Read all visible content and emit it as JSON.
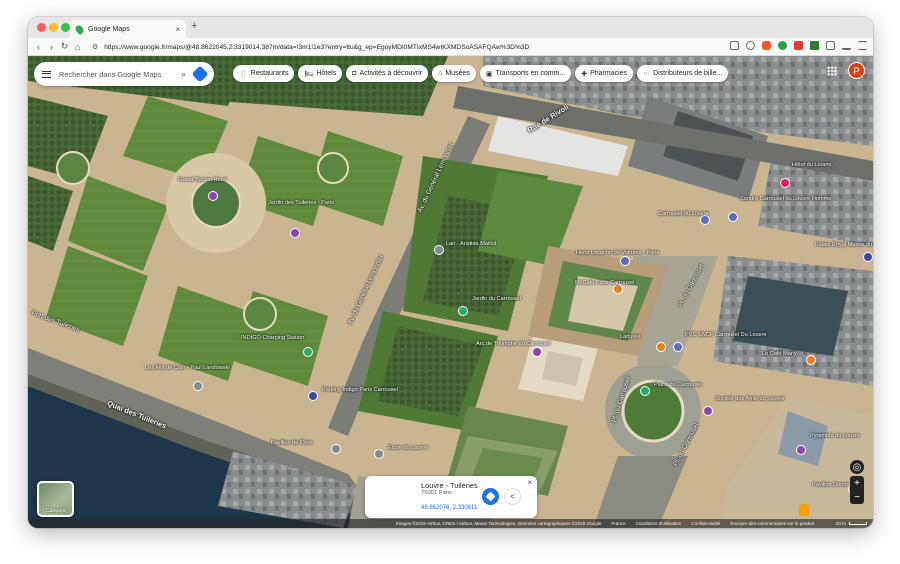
{
  "browser": {
    "tab_title": "Google Maps",
    "tab_close": "×",
    "new_tab": "+",
    "url": "https://www.google.fr/maps/@48.8622045,2.3319014,387m/data=!3m1!1e3?entry=ttu&g_ep=EgoyMDI0MTIxMS4wIKXMDSoASAFQAw%3D%3D",
    "nav": {
      "back": "‹",
      "forward": "›",
      "reload": "↻",
      "home": "⌂"
    },
    "traffic_colors": [
      "#ff5f57",
      "#febc2e",
      "#28c840"
    ]
  },
  "maps": {
    "search_placeholder": "Rechercher dans Google Maps",
    "chips": [
      {
        "icon": "restaurant-icon",
        "glyph": "🍴",
        "label": "Restaurants"
      },
      {
        "icon": "hotel-icon",
        "glyph": "🛏",
        "label": "Hôtels"
      },
      {
        "icon": "camera-icon",
        "glyph": "◘",
        "label": "Activités à découvrir"
      },
      {
        "icon": "museum-icon",
        "glyph": "⌂",
        "label": "Musées"
      },
      {
        "icon": "transit-icon",
        "glyph": "▣",
        "label": "Transports en comm..."
      },
      {
        "icon": "pharmacy-icon",
        "glyph": "✚",
        "label": "Pharmacies"
      },
      {
        "icon": "atm-icon",
        "glyph": "···",
        "label": "Distributeurs de bille..."
      }
    ],
    "avatar_initial": "P",
    "layers_label": "Calques",
    "zoom_in": "+",
    "zoom_out": "−",
    "places": [
      {
        "name": "Grand Bassin Rond",
        "pin_color": "#8e44ad"
      },
      {
        "name": "Jardin des Tuileries - Paris",
        "pin_color": "#8e44ad"
      },
      {
        "name": "Lair - Aristide Maillol",
        "pin_color": "#7f8c8d"
      },
      {
        "name": "Hertz Location de Voitures - Paris",
        "pin_color": "#5c6bc0"
      },
      {
        "name": "McCafé Paris Carrousel",
        "pin_color": "#e67e22"
      },
      {
        "name": "Jardin du Carrousel",
        "pin_color": "#27ae60"
      },
      {
        "name": "Arc de Triomphe du Carrousel",
        "pin_color": "#8e44ad"
      },
      {
        "name": "INDIGO Charging Station",
        "pin_color": "#27ae60"
      },
      {
        "name": "Les Fils de Caïn - Paul Landowski",
        "pin_color": "#7f8c8d"
      },
      {
        "name": "Parking Indigo Paris Carrousel",
        "pin_color": "#3949ab"
      },
      {
        "name": "Pavillon de Flore",
        "pin_color": "#7f8c8d"
      },
      {
        "name": "Ecole du Louvre",
        "pin_color": "#7f8c8d"
      },
      {
        "name": "Carrousel du Louvre",
        "pin_color": "#5c6bc0"
      },
      {
        "name": "Sandro Carrousel du Louvre Homme",
        "pin_color": "#5c6bc0"
      },
      {
        "name": "Hôtel du Louvre",
        "pin_color": "#e91e63"
      },
      {
        "name": "Palais Royal Musée du Louvre",
        "pin_color": "#3949ab"
      },
      {
        "name": "Ladurée",
        "pin_color": "#e67e22"
      },
      {
        "name": "PVC SNCF Carrousel Du Louvre",
        "pin_color": "#5c6bc0"
      },
      {
        "name": "Le Café Marly",
        "pin_color": "#e67e22"
      },
      {
        "name": "Place du Carrousel",
        "pin_color": "#27ae60"
      },
      {
        "name": "Société des Amis du Louvre",
        "pin_color": "#8e44ad"
      },
      {
        "name": "Pyramide du Louvre",
        "pin_color": "#8e44ad"
      },
      {
        "name": "Pavillon Denon",
        "pin_color": "#7f8c8d"
      }
    ],
    "streets": [
      "Rue de Rivoli",
      "Av. du Général Lemonnier",
      "Av. du Général Lemonnier",
      "Quai des Tuileries",
      "Pl. du Carrousel",
      "Pl. du Carrousel",
      "Pl. du Carrousel",
      "Port des Tuileries"
    ],
    "info": {
      "title": "Louvre - Tuileries",
      "subtitle": "75001 Paris",
      "coords": "48.862076, 2.330611",
      "close": "×",
      "share": "<"
    },
    "footer": {
      "attribution": "Images ©2025 Airbus, CNES / Airbus, Maxar Technologies, Données cartographiques ©2025 Google",
      "links": [
        "France",
        "Conditions d'utilisation",
        "Confidentialité",
        "Envoyer des commentaires sur le produit"
      ],
      "scale": "20 m"
    }
  }
}
